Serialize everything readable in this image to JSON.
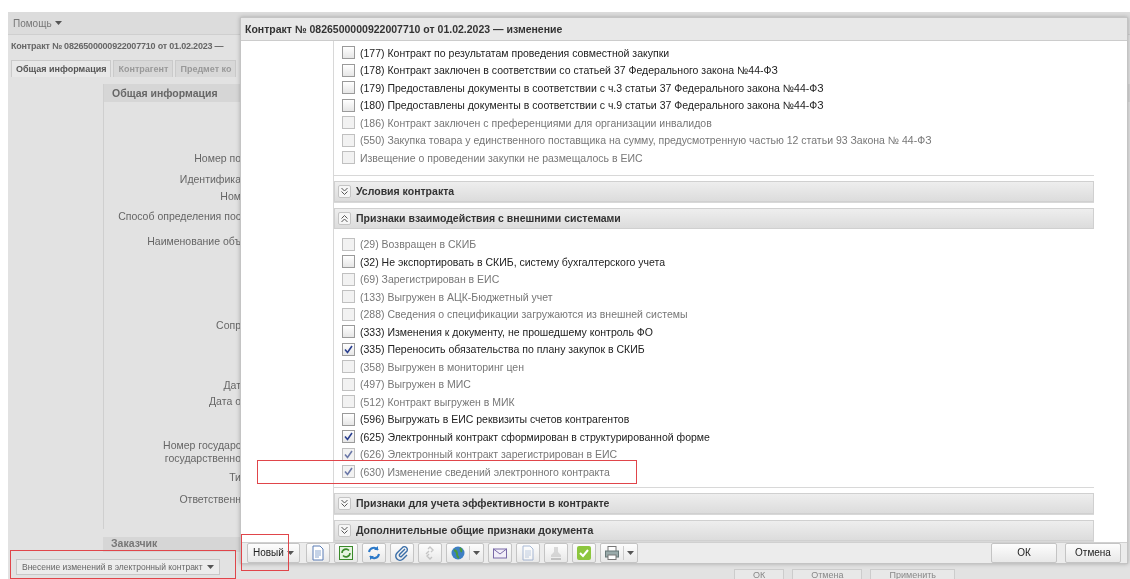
{
  "background": {
    "menu": "Помощь",
    "title": "Контракт № 0826500000922007710 от 01.02.2023 —",
    "tabs": [
      {
        "label": "Общая информация",
        "selected": true
      },
      {
        "label": "Контрагент",
        "selected": false
      },
      {
        "label": "Предмет ко",
        "selected": false
      }
    ],
    "section": "Общая информация",
    "labels": [
      "Номер по",
      "Идентифика",
      "Ном",
      "Способ определения пос",
      "Наименование объ",
      "Сопр",
      "Дат",
      "Дата о",
      "Номер государс\nгосударственно",
      "Ти",
      "Ответственн"
    ],
    "next_section": "Заказчик",
    "action_button": {
      "label": "Внесение изменений в электронный контракт",
      "highlighted": true
    },
    "buttons": [
      "ОК",
      "Отмена",
      "Применить"
    ]
  },
  "dialog": {
    "title": "Контракт № 0826500000922007710 от 01.02.2023 — изменение",
    "top_items": [
      {
        "label": "(177) Контракт по результатам проведения совместной закупки",
        "checked": false,
        "disabled": false,
        "highlighted": false
      },
      {
        "label": "(178) Контракт заключен в соответствии со статьей 37 Федерального закона №44-ФЗ",
        "checked": false,
        "disabled": false,
        "highlighted": false
      },
      {
        "label": "(179) Предоставлены документы в соответствии с ч.3 статьи 37 Федерального закона №44-ФЗ",
        "checked": false,
        "disabled": false,
        "highlighted": false
      },
      {
        "label": "(180) Предоставлены документы в соответствии с ч.9 статьи 37 Федерального закона №44-ФЗ",
        "checked": false,
        "disabled": false,
        "highlighted": false
      },
      {
        "label": "(186) Контракт заключен с преференциями для организации инвалидов",
        "checked": false,
        "disabled": true,
        "highlighted": false
      },
      {
        "label": "(550) Закупка товара у единственного поставщика на сумму, предусмотренную частью 12 статьи 93 Закона № 44-ФЗ",
        "checked": false,
        "disabled": true,
        "highlighted": false
      },
      {
        "label": "Извещение о проведении закупки не размещалось в ЕИС",
        "checked": false,
        "disabled": true,
        "highlighted": false
      }
    ],
    "sections": [
      {
        "title": "Условия контракта",
        "expanded": false
      },
      {
        "title": "Признаки взаимодействия с внешними системами",
        "expanded": true,
        "items": [
          {
            "label": "(29) Возвращен в СКИБ",
            "checked": false,
            "disabled": true,
            "highlighted": false
          },
          {
            "label": "(32) Не экспортировать в СКИБ, систему бухгалтерского учета",
            "checked": false,
            "disabled": false,
            "highlighted": false
          },
          {
            "label": "(69) Зарегистрирован в ЕИС",
            "checked": false,
            "disabled": true,
            "highlighted": false
          },
          {
            "label": "(133) Выгружен в АЦК-Бюджетный учет",
            "checked": false,
            "disabled": true,
            "highlighted": false
          },
          {
            "label": "(288) Сведения о спецификации загружаются из внешней системы",
            "checked": false,
            "disabled": true,
            "highlighted": false
          },
          {
            "label": "(333) Изменения к документу, не прошедшему контроль ФО",
            "checked": false,
            "disabled": false,
            "highlighted": false
          },
          {
            "label": "(335) Переносить обязательства по плану закупок в СКИБ",
            "checked": true,
            "disabled": false,
            "highlighted": false
          },
          {
            "label": "(358) Выгружен в мониторинг цен",
            "checked": false,
            "disabled": true,
            "highlighted": false
          },
          {
            "label": "(497) Выгружен в МИС",
            "checked": false,
            "disabled": true,
            "highlighted": false
          },
          {
            "label": "(512) Контракт выгружен в МИК",
            "checked": false,
            "disabled": true,
            "highlighted": false
          },
          {
            "label": "(596) Выгружать в ЕИС реквизиты счетов контрагентов",
            "checked": false,
            "disabled": false,
            "highlighted": false
          },
          {
            "label": "(625) Электронный контракт сформирован в структурированной форме",
            "checked": true,
            "disabled": false,
            "highlighted": false
          },
          {
            "label": "(626) Электронный контракт зарегистрирован в ЕИС",
            "checked": true,
            "disabled": true,
            "highlighted": false
          },
          {
            "label": "(630) Изменение сведений электронного контракта",
            "checked": true,
            "disabled": true,
            "highlighted": true
          }
        ]
      },
      {
        "title": "Признаки для учета эффективности в контракте",
        "expanded": false
      },
      {
        "title": "Дополнительные общие признаки документа",
        "expanded": false
      }
    ],
    "new_button": {
      "label": "Новый",
      "highlighted": true
    },
    "toolbar": [
      {
        "disabled": false,
        "has_menu": false
      },
      {
        "disabled": false,
        "has_menu": false
      },
      {
        "disabled": false,
        "has_menu": false
      },
      {
        "disabled": false,
        "has_menu": false
      },
      {
        "disabled": true,
        "has_menu": false
      },
      {
        "disabled": false,
        "has_menu": true
      },
      {
        "disabled": false,
        "has_menu": false
      },
      {
        "disabled": true,
        "has_menu": false
      },
      {
        "disabled": true,
        "has_menu": false
      },
      {
        "disabled": false,
        "has_menu": false
      },
      {
        "disabled": false,
        "has_menu": true
      }
    ],
    "buttons": [
      "ОК",
      "Отмена"
    ]
  }
}
